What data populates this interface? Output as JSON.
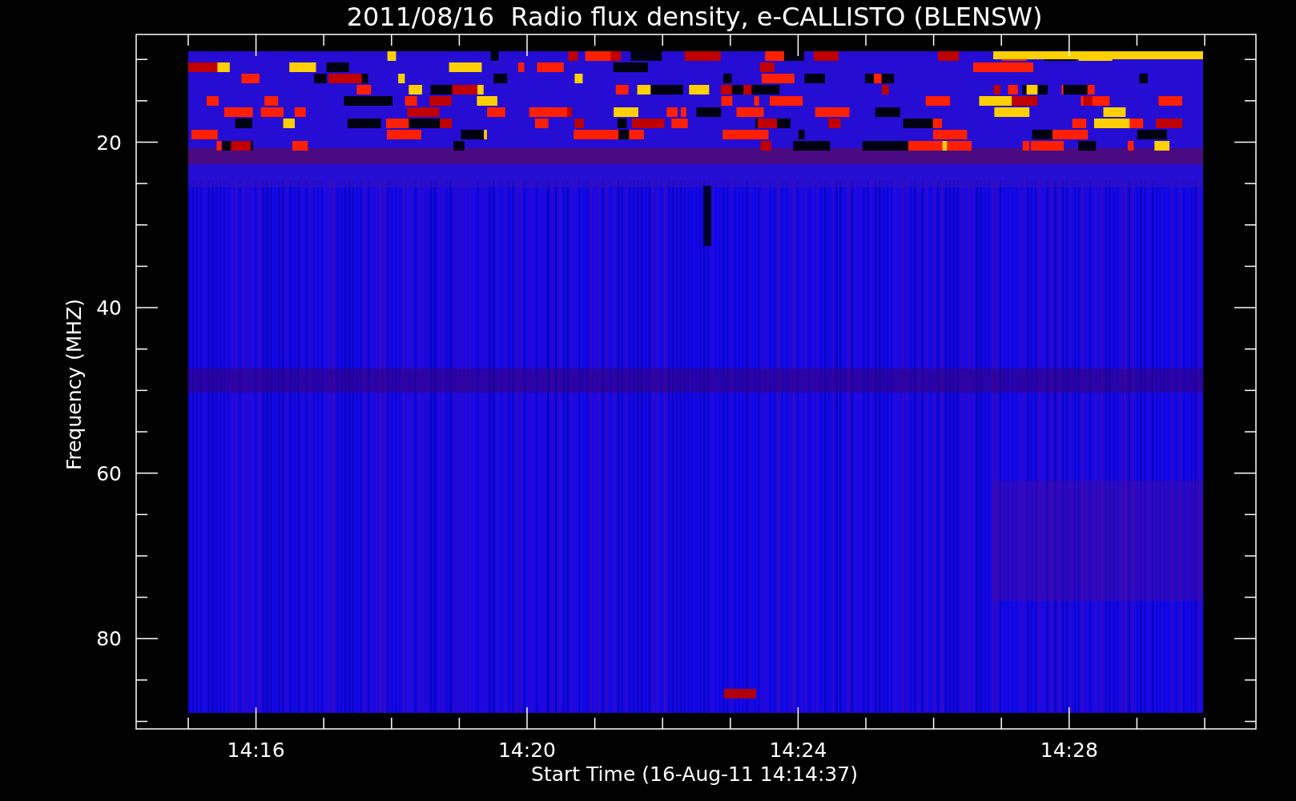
{
  "title": "2011/08/16  Radio flux density, e-CALLISTO (BLENSW)",
  "y_axis": {
    "label": "Frequency (MHZ)",
    "ticks": [
      "20",
      "40",
      "60",
      "80"
    ]
  },
  "x_axis": {
    "label": "Start Time (16-Aug-11 14:14:37)",
    "ticks": [
      "14:16",
      "14:20",
      "14:24",
      "14:28"
    ]
  }
}
